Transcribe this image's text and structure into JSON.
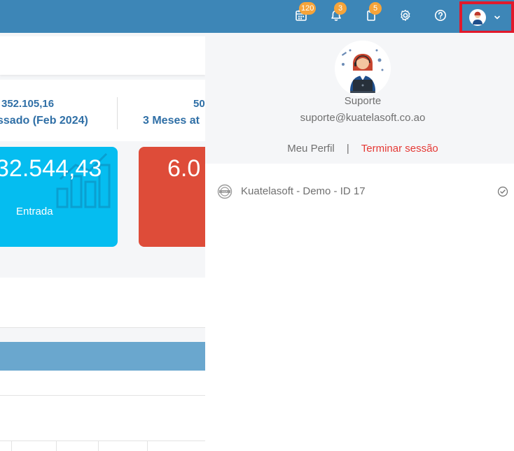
{
  "topbar": {
    "background": "#3d86b7",
    "icons": [
      {
        "name": "calendar-icon",
        "badge": "120"
      },
      {
        "name": "bell-icon",
        "badge": "3"
      },
      {
        "name": "clipboard-icon",
        "badge": "5"
      },
      {
        "name": "gear-icon",
        "badge": ""
      },
      {
        "name": "help-icon",
        "badge": ""
      }
    ],
    "user_menu_icon": "chevron-down-icon",
    "highlight_color": "#e1192b"
  },
  "dashboard": {
    "stat_left_value": "352.105,16",
    "stat_left_label": "ssado (Feb 2024)",
    "stat_right_value": "50",
    "stat_right_label": "3 Meses at",
    "card_blue": {
      "value": "32.544,43",
      "label": "Entrada",
      "color": "#05bdf0"
    },
    "card_red": {
      "value": "6.0",
      "color": "#de4c39"
    }
  },
  "user_panel": {
    "name": "Suporte",
    "email": "suporte@kuatelasoft.co.ao",
    "profile_link": "Meu Perfil",
    "separator": "|",
    "logout_link": "Terminar sessão",
    "logout_color": "#e53935",
    "companies": [
      {
        "name": "Kuatelasoft - Demo - ID 17",
        "selected": true
      }
    ]
  }
}
